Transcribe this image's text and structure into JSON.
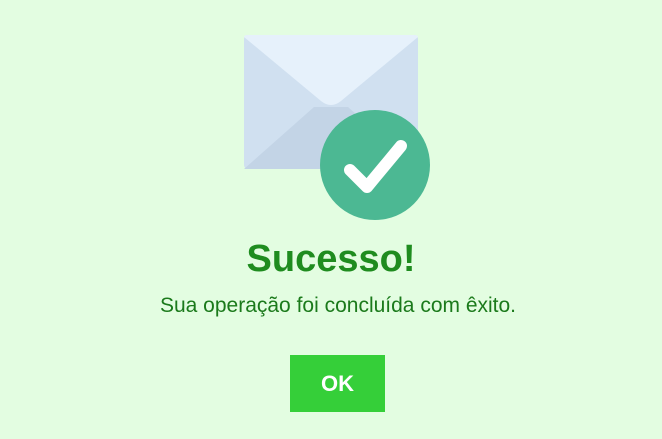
{
  "dialog": {
    "icon": "envelope-check-icon",
    "title": "Sucesso!",
    "message": "Sua operação foi concluída com êxito.",
    "ok_label": "OK"
  },
  "colors": {
    "background": "#e3fde1",
    "title": "#1f8c1f",
    "message": "#1b7a1b",
    "button": "#35cf39",
    "check_badge": "#4cb893",
    "envelope": "#cfdff0"
  }
}
